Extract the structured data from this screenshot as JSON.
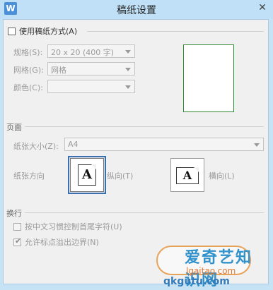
{
  "window": {
    "title": "稿纸设置",
    "app_icon_letter": "W",
    "close_glyph": "✕"
  },
  "manuscript": {
    "use_label": "使用稿纸方式(A)",
    "use_checked": false,
    "spec_label": "规格(S):",
    "spec_value": "20 x 20 (400 字)",
    "grid_label": "网格(G):",
    "grid_value": "网格",
    "color_label": "颜色(C):",
    "color_value": ""
  },
  "page": {
    "section_title": "页面",
    "paper_size_label": "纸张大小(Z):",
    "paper_size_value": "A4",
    "orientation_label": "纸张方向",
    "portrait_label": "纵向(T)",
    "landscape_label": "横向(L)",
    "portrait_selected": true,
    "glyph_letter": "A"
  },
  "line_break": {
    "section_title": "换行",
    "option1_label": "按中文习惯控制首尾字符(U)",
    "option1_checked": false,
    "option2_label": "允许标点溢出边界(N)",
    "option2_checked": true
  },
  "watermark": {
    "line1": "爱奇艺知识网",
    "line2": "lgaitao.com",
    "line3": "qkgutu.com"
  },
  "colors": {
    "titlebar": "#bfe0f6",
    "preview_border": "#2f8a2f",
    "selected_outline": "#3b6fb0"
  }
}
